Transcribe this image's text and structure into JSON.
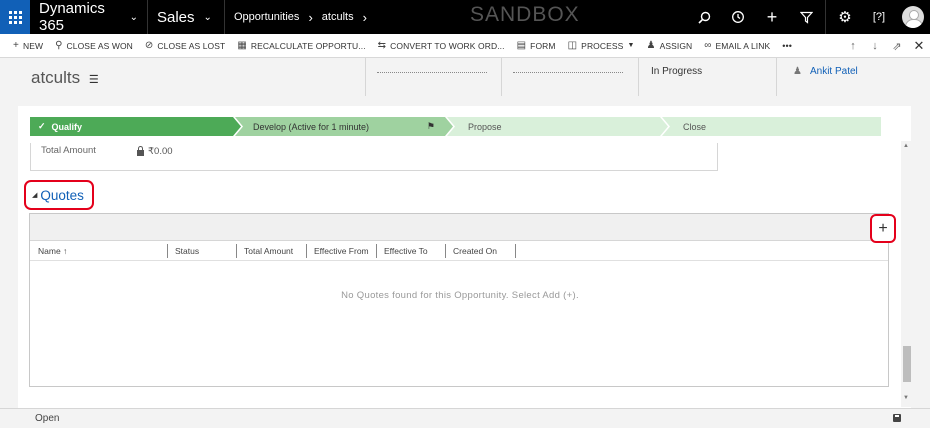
{
  "topbar": {
    "app_name": "Dynamics 365",
    "module": "Sales",
    "breadcrumb": [
      "Opportunities",
      "atcults"
    ],
    "environment": "SANDBOX",
    "icons": [
      "search-icon",
      "history-icon",
      "plus-icon",
      "filter-icon",
      "gear-icon",
      "help-icon"
    ]
  },
  "commands": [
    {
      "icon": "plus-icon",
      "label": "NEW"
    },
    {
      "icon": "trophy-icon",
      "label": "CLOSE AS WON"
    },
    {
      "icon": "no-entry-icon",
      "label": "CLOSE AS LOST"
    },
    {
      "icon": "calculator-icon",
      "label": "RECALCULATE OPPORTU..."
    },
    {
      "icon": "convert-icon",
      "label": "CONVERT TO WORK ORD..."
    },
    {
      "icon": "form-icon",
      "label": "FORM"
    },
    {
      "icon": "process-icon",
      "label": "PROCESS"
    },
    {
      "icon": "assign-icon",
      "label": "ASSIGN"
    },
    {
      "icon": "link-icon",
      "label": "EMAIL A LINK"
    },
    {
      "icon": "more-icon",
      "label": "•••"
    }
  ],
  "header": {
    "record_name": "atcults",
    "status": "In Progress",
    "owner": "Ankit Patel"
  },
  "process": {
    "stages": [
      {
        "label": "Qualify",
        "state": "done"
      },
      {
        "label": "Develop (Active for 1 minute)",
        "state": "active"
      },
      {
        "label": "Propose",
        "state": "todo"
      },
      {
        "label": "Close",
        "state": "todo"
      }
    ]
  },
  "summary": {
    "total_amount_label": "Total Amount",
    "total_amount_value": "₹0.00"
  },
  "quotes": {
    "title": "Quotes",
    "add_label": "+",
    "columns": [
      "Name ↑",
      "Status",
      "Total Amount",
      "Effective From",
      "Effective To",
      "Created On"
    ],
    "empty_message": "No Quotes found for this Opportunity. Select Add (+)."
  },
  "footer": {
    "status": "Open"
  },
  "colors": {
    "nav_bg": "#000000",
    "brand_blue": "#1160b7",
    "stage_done": "#4daa57",
    "stage_active": "#9fd2a0",
    "stage_todo": "#d9f0da",
    "highlight_red": "#e4001b"
  }
}
